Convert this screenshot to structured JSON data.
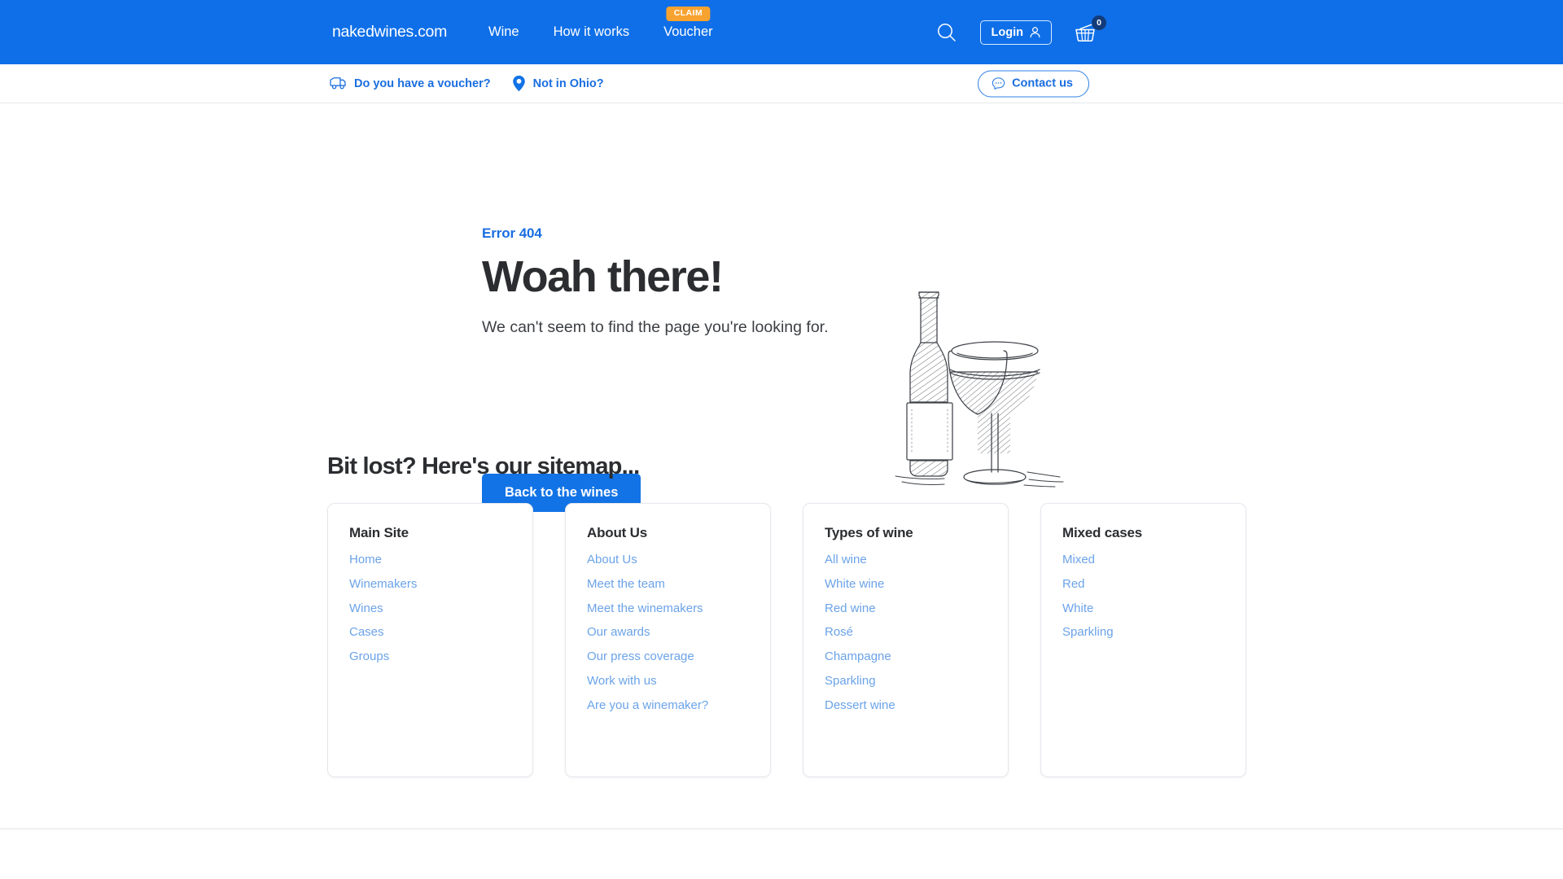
{
  "colors": {
    "brand_blue": "#0f6fe8",
    "link_blue": "#1a6ee0",
    "sitemap_link_blue": "#6ba3e8",
    "claim_orange": "#f8a230",
    "badge_navy": "#123b7a",
    "heading_dark": "#2b2d30",
    "cta_blue": "#1273e6"
  },
  "header": {
    "logo": "nakedwines.com",
    "nav": [
      {
        "label": "Wine",
        "badge": null
      },
      {
        "label": "How it works",
        "badge": null
      },
      {
        "label": "Voucher",
        "badge": "CLAIM"
      }
    ],
    "search_icon": "search-icon",
    "login_label": "Login",
    "login_icon": "user-icon",
    "basket_icon": "basket-icon",
    "basket_count": "0"
  },
  "secondary_bar": {
    "items": [
      {
        "label": "Do you have a voucher?",
        "icon": "delivery-van-icon"
      },
      {
        "label": "Not in Ohio?",
        "icon": "location-pin-icon"
      }
    ],
    "contact_label": "Contact us",
    "contact_icon": "chat-bubble-icon"
  },
  "hero": {
    "error_code": "Error 404",
    "title": "Woah there!",
    "subtitle": "We can't seem to find the page you're looking for.",
    "cta_label": "Back to the wines",
    "illustration": "wine-bottle-and-glass-sketch"
  },
  "sitemap": {
    "title": "Bit lost? Here's our sitemap...",
    "columns": [
      {
        "title": "Main Site",
        "links": [
          "Home",
          "Winemakers",
          "Wines",
          "Cases",
          "Groups"
        ]
      },
      {
        "title": "About Us",
        "links": [
          "About Us",
          "Meet the team",
          "Meet the winemakers",
          "Our awards",
          "Our press coverage",
          "Work with us",
          "Are you a winemaker?"
        ]
      },
      {
        "title": "Types of wine",
        "links": [
          "All wine",
          "White wine",
          "Red wine",
          "Rosé",
          "Champagne",
          "Sparkling",
          "Dessert wine"
        ]
      },
      {
        "title": "Mixed cases",
        "links": [
          "Mixed",
          "Red",
          "White",
          "Sparkling"
        ]
      }
    ]
  }
}
